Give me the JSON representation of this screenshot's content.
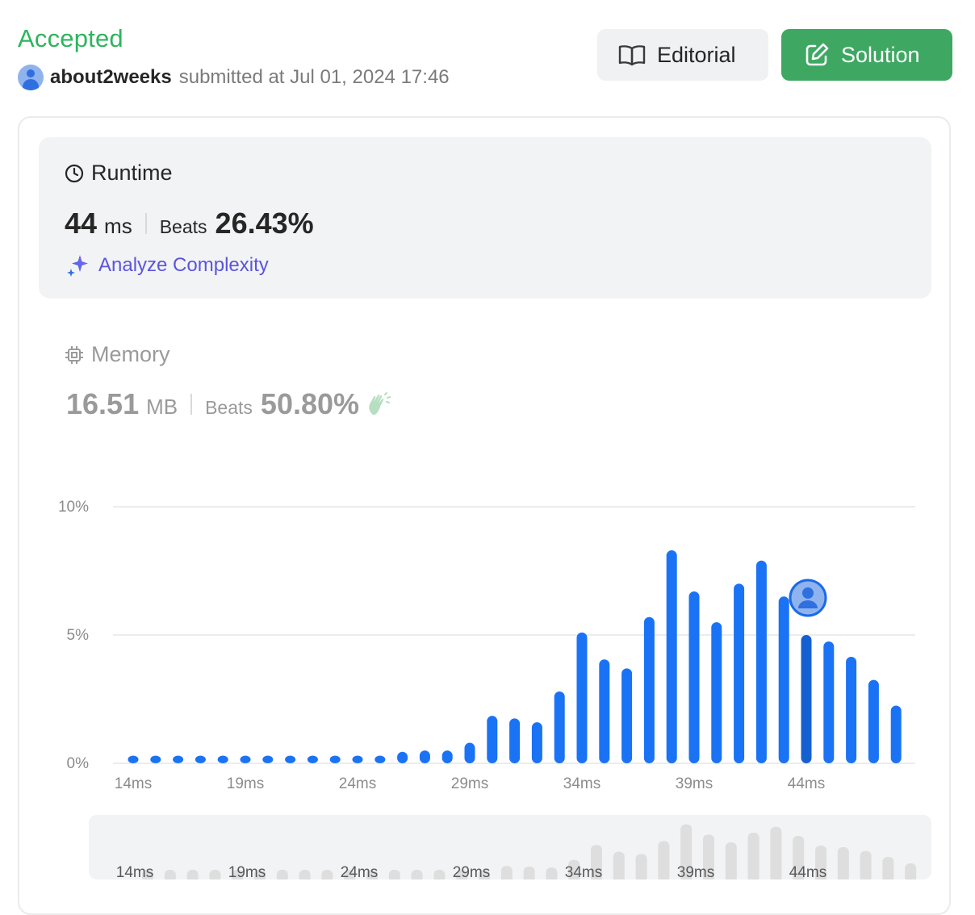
{
  "header": {
    "status": "Accepted",
    "username": "about2weeks",
    "submitted_text": "submitted at Jul 01, 2024 17:46",
    "editorial_label": "Editorial",
    "solution_label": "Solution"
  },
  "runtime": {
    "title": "Runtime",
    "value": "44",
    "unit": "ms",
    "beats_label": "Beats",
    "beats_value": "26.43%",
    "analyze_label": "Analyze Complexity"
  },
  "memory": {
    "title": "Memory",
    "value": "16.51",
    "unit": "MB",
    "beats_label": "Beats",
    "beats_value": "50.80%"
  },
  "colors": {
    "accepted": "#2db55d",
    "bar": "#1a73f5",
    "bar_selected": "#1560d0",
    "solution_button": "#3ea862"
  },
  "chart_data": {
    "type": "bar",
    "x": [
      14,
      15,
      16,
      17,
      18,
      19,
      20,
      21,
      22,
      23,
      24,
      25,
      26,
      27,
      28,
      29,
      30,
      31,
      32,
      33,
      34,
      35,
      36,
      37,
      38,
      39,
      40,
      41,
      42,
      43,
      44,
      45,
      46,
      47,
      48
    ],
    "values": [
      0.3,
      0.3,
      0.3,
      0.3,
      0.3,
      0.3,
      0.3,
      0.3,
      0.3,
      0.3,
      0.3,
      0.3,
      0.45,
      0.5,
      0.5,
      0.8,
      1.85,
      1.75,
      1.6,
      2.8,
      5.1,
      4.05,
      3.7,
      5.7,
      8.3,
      6.7,
      5.5,
      7.0,
      7.9,
      6.5,
      5.0,
      4.75,
      4.15,
      3.25,
      2.25
    ],
    "xticks": [
      "14ms",
      "19ms",
      "24ms",
      "29ms",
      "34ms",
      "39ms",
      "44ms"
    ],
    "yticks": [
      "0%",
      "5%",
      "10%"
    ],
    "ylim": [
      0,
      10
    ],
    "selected": 44
  }
}
